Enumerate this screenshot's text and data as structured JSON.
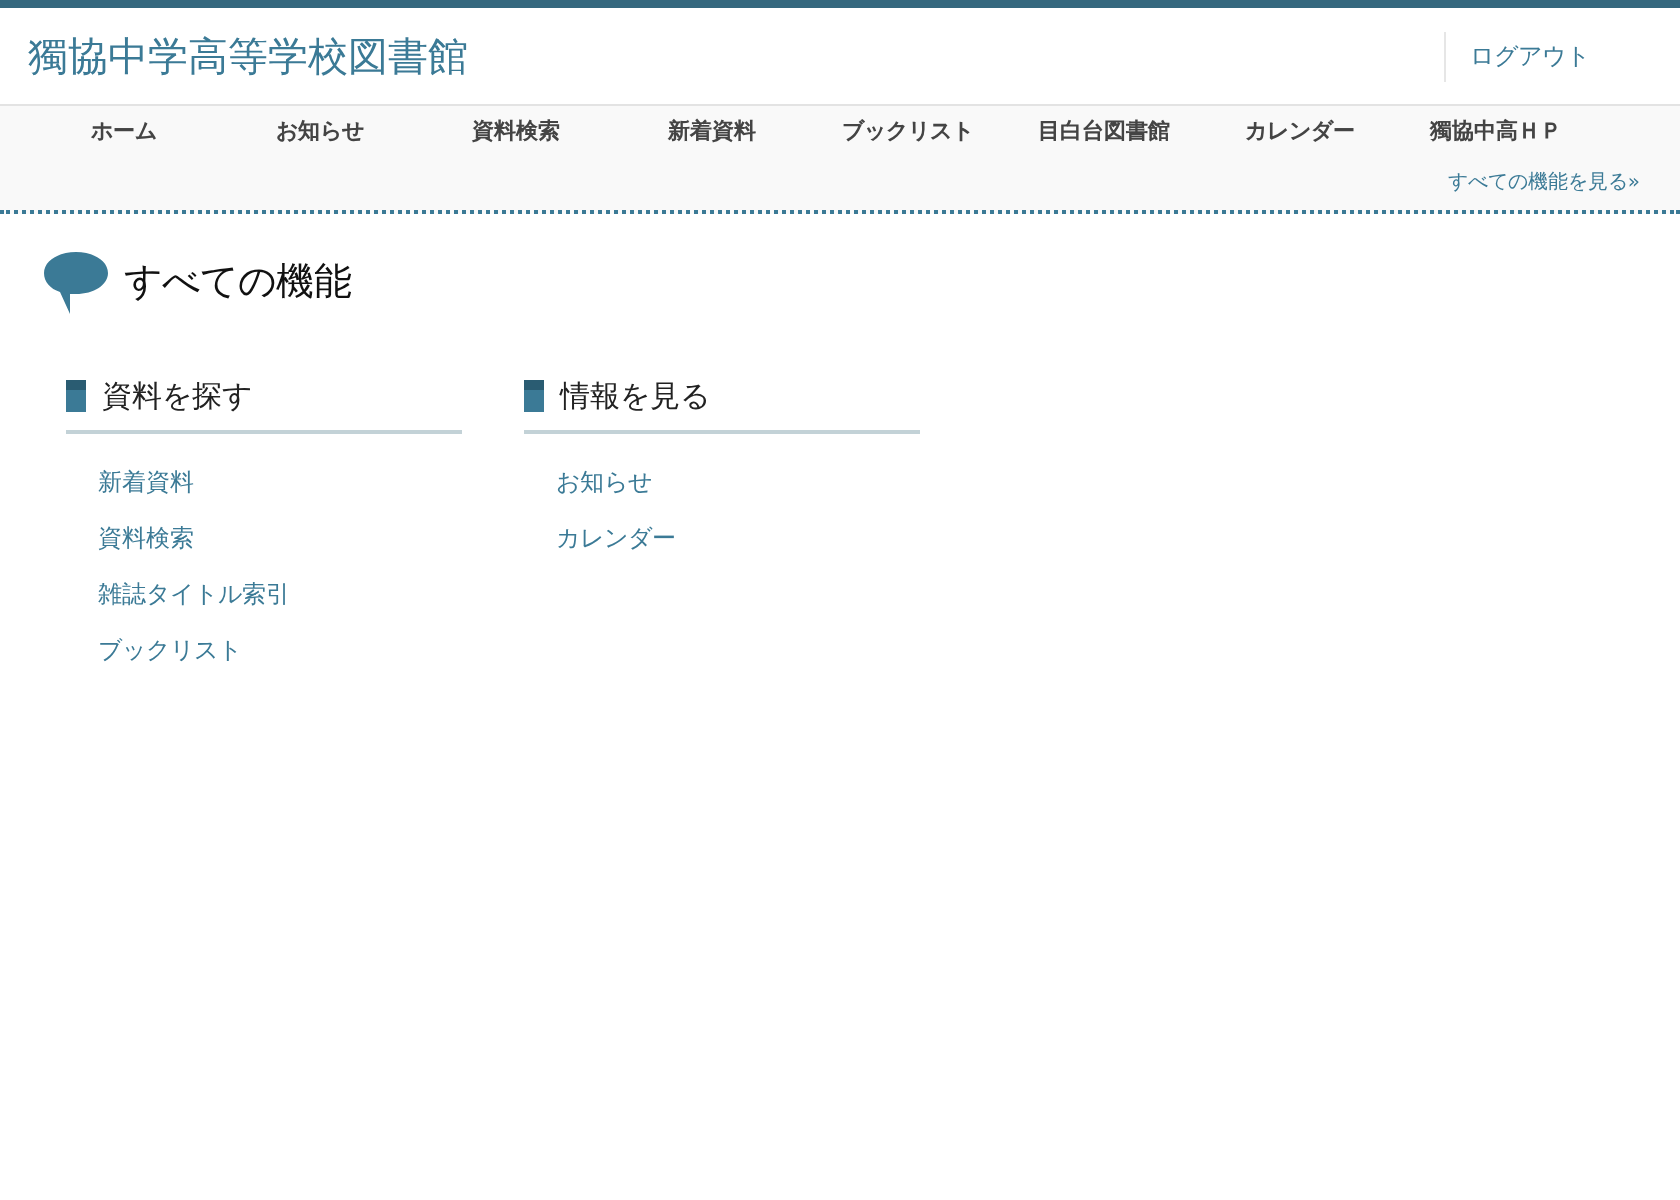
{
  "header": {
    "site_title": "獨協中学高等学校図書館",
    "logout": "ログアウト"
  },
  "nav": {
    "items": [
      "ホーム",
      "お知らせ",
      "資料検索",
      "新着資料",
      "ブックリスト",
      "目白台図書館",
      "カレンダー",
      "獨協中高ＨＰ"
    ],
    "all_features_link": "すべての機能を見る»"
  },
  "page": {
    "title": "すべての機能",
    "sections": [
      {
        "heading": "資料を探す",
        "links": [
          "新着資料",
          "資料検索",
          "雑誌タイトル索引",
          "ブックリスト"
        ]
      },
      {
        "heading": "情報を見る",
        "links": [
          "お知らせ",
          "カレンダー"
        ]
      }
    ]
  }
}
